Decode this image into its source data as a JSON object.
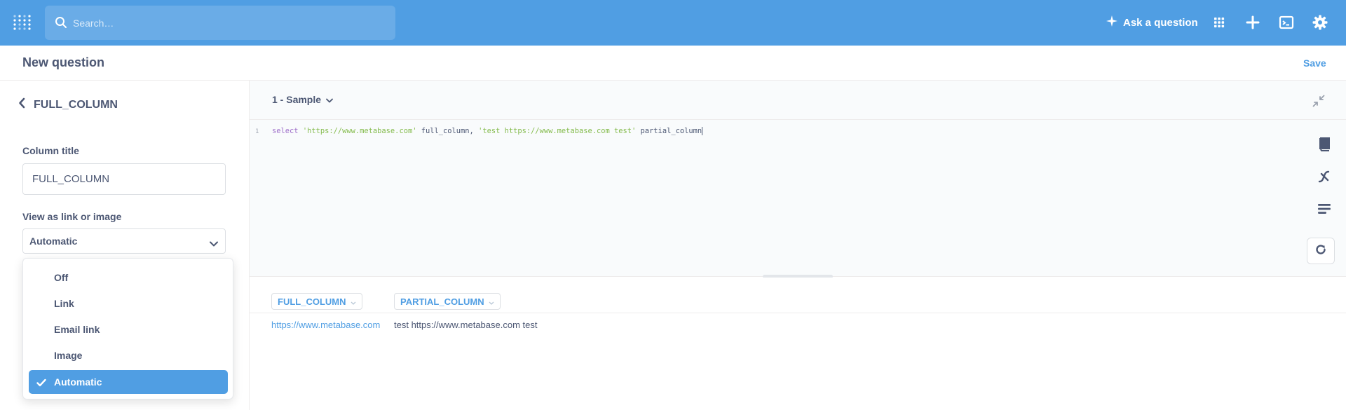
{
  "nav": {
    "search_placeholder": "Search…",
    "ask_label": "Ask a question"
  },
  "header": {
    "title": "New question",
    "save_label": "Save"
  },
  "sidebar": {
    "column_name": "FULL_COLUMN",
    "column_title_label": "Column title",
    "column_title_value": "FULL_COLUMN",
    "view_as_label": "View as link or image",
    "view_as_selected": "Automatic",
    "options": [
      {
        "label": "Off",
        "selected": false
      },
      {
        "label": "Link",
        "selected": false
      },
      {
        "label": "Email link",
        "selected": false
      },
      {
        "label": "Image",
        "selected": false
      },
      {
        "label": "Automatic",
        "selected": true
      }
    ]
  },
  "editor": {
    "database": "1 - Sample",
    "line_number": "1",
    "code": {
      "kw_select": "select",
      "str_1": "'https://www.metabase.com'",
      "plain_1": " full_column, ",
      "str_2": "'test https://www.metabase.com test'",
      "plain_2": " partial_column"
    }
  },
  "results": {
    "columns": [
      "FULL_COLUMN",
      "PARTIAL_COLUMN"
    ],
    "rows": [
      [
        "https://www.metabase.com",
        "test https://www.metabase.com test"
      ]
    ]
  },
  "colors": {
    "brand": "#509ee3",
    "text_dark": "#4c5773",
    "sql_keyword": "#9e6ec9",
    "sql_string": "#84bb4c"
  },
  "icons": [
    "metabase-logo-icon",
    "search-icon",
    "sparkle-icon",
    "grid-icon",
    "plus-icon",
    "terminal-icon",
    "gear-icon",
    "chevron-left-icon",
    "chevron-down-icon",
    "check-icon",
    "collapse-icon",
    "book-icon",
    "variable-icon",
    "snippet-icon",
    "refresh-icon"
  ]
}
